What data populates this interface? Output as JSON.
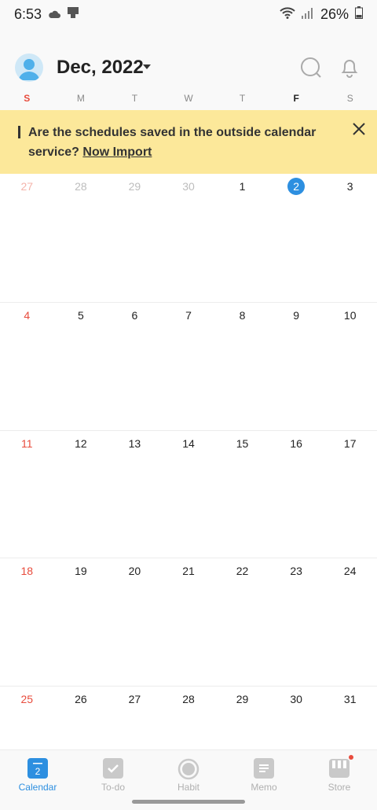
{
  "status": {
    "time": "6:53",
    "battery": "26%"
  },
  "header": {
    "month": "Dec, 2022"
  },
  "weekdays": [
    "S",
    "M",
    "T",
    "W",
    "T",
    "F",
    "S"
  ],
  "banner": {
    "text": "Are the schedules saved in the outside calendar service?",
    "link": "Now Import"
  },
  "weeks": [
    [
      "27",
      "28",
      "29",
      "30",
      "1",
      "2",
      "3"
    ],
    [
      "4",
      "5",
      "6",
      "7",
      "8",
      "9",
      "10"
    ],
    [
      "11",
      "12",
      "13",
      "14",
      "15",
      "16",
      "17"
    ],
    [
      "18",
      "19",
      "20",
      "21",
      "22",
      "23",
      "24"
    ],
    [
      "25",
      "26",
      "27",
      "28",
      "29",
      "30",
      "31"
    ]
  ],
  "today": "2",
  "tabs": [
    {
      "label": "Calendar",
      "icon": "calendar-icon",
      "icon_text": "2"
    },
    {
      "label": "To-do",
      "icon": "checkbox-icon"
    },
    {
      "label": "Habit",
      "icon": "habit-icon"
    },
    {
      "label": "Memo",
      "icon": "memo-icon"
    },
    {
      "label": "Store",
      "icon": "store-icon"
    }
  ],
  "colors": {
    "accent": "#2d8fe0",
    "sunday": "#e84c3d",
    "banner": "#fce89a"
  }
}
